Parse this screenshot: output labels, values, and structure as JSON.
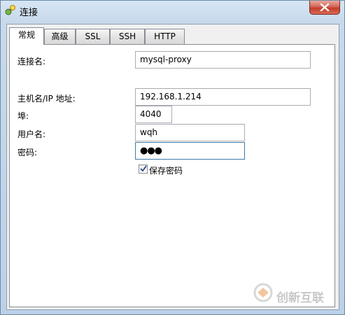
{
  "window": {
    "title": "连接",
    "close_icon": "close-icon"
  },
  "tabs": [
    {
      "label": "常规",
      "active": true
    },
    {
      "label": "高级",
      "active": false
    },
    {
      "label": "SSL",
      "active": false
    },
    {
      "label": "SSH",
      "active": false
    },
    {
      "label": "HTTP",
      "active": false
    }
  ],
  "form": {
    "connection_name": {
      "label": "连接名:",
      "value": "mysql-proxy"
    },
    "host": {
      "label": "主机名/IP 地址:",
      "value": "192.168.1.214"
    },
    "port": {
      "label": "埠:",
      "value": "4040"
    },
    "user": {
      "label": "用户名:",
      "value": "wqh"
    },
    "password": {
      "label": "密码:",
      "value": "●●●"
    },
    "save_password": {
      "label": "保存密码",
      "checked": true
    }
  },
  "watermark": {
    "text": "创新互联"
  }
}
